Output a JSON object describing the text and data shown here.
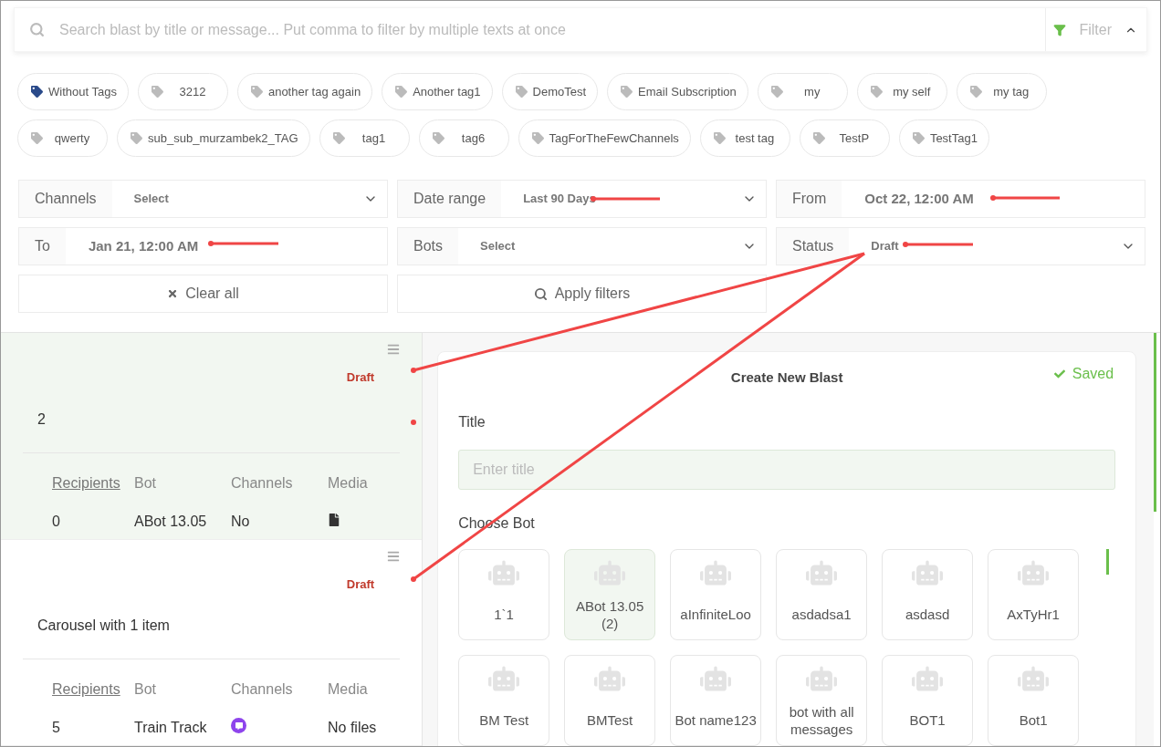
{
  "search": {
    "placeholder": "Search blast by title or message... Put comma to filter by multiple texts at once"
  },
  "filter_toggle": {
    "label": "Filter",
    "expanded": true
  },
  "tags": [
    {
      "label": "Without Tags",
      "kind": "none"
    },
    {
      "label": "3212",
      "kind": "tag"
    },
    {
      "label": "another tag again",
      "kind": "tag"
    },
    {
      "label": "Another tag1",
      "kind": "tag"
    },
    {
      "label": "DemoTest",
      "kind": "tag"
    },
    {
      "label": "Email Subscription",
      "kind": "tag"
    },
    {
      "label": "my",
      "kind": "tag"
    },
    {
      "label": "my self",
      "kind": "tag"
    },
    {
      "label": "my tag",
      "kind": "tag"
    },
    {
      "label": "qwerty",
      "kind": "tag"
    },
    {
      "label": "sub_sub_murzambek2_TAG",
      "kind": "tag"
    },
    {
      "label": "tag1",
      "kind": "tag"
    },
    {
      "label": "tag6",
      "kind": "tag"
    },
    {
      "label": "TagForTheFewChannels",
      "kind": "tag"
    },
    {
      "label": "test tag",
      "kind": "tag"
    },
    {
      "label": "TestP",
      "kind": "tag"
    },
    {
      "label": "TestTag1",
      "kind": "tag"
    }
  ],
  "filters": [
    {
      "label": "Channels",
      "value": "Select",
      "kind": "select"
    },
    {
      "label": "Date range",
      "value": "Last 90 Days",
      "kind": "select"
    },
    {
      "label": "From",
      "value": "Oct 22, 12:00 AM",
      "kind": "date"
    },
    {
      "label": "To",
      "value": "Jan 21, 12:00 AM",
      "kind": "date"
    },
    {
      "label": "Bots",
      "value": "Select",
      "kind": "select"
    },
    {
      "label": "Status",
      "value": "Draft",
      "kind": "select"
    }
  ],
  "filter_buttons": [
    {
      "label": "Clear all",
      "kind": "clear"
    },
    {
      "label": "Apply filters",
      "kind": "apply"
    }
  ],
  "blasts": [
    {
      "status": "Draft",
      "title": "2",
      "selected": true,
      "columns": [
        "Recipients",
        "Bot",
        "Channels",
        "Media"
      ],
      "recipients": "0",
      "bot": "ABot 13.05",
      "channels": {
        "kind": "text",
        "text": "No"
      },
      "media": {
        "kind": "file"
      }
    },
    {
      "status": "Draft",
      "title": "Carousel with 1 item",
      "selected": false,
      "columns": [
        "Recipients",
        "Bot",
        "Channels",
        "Media"
      ],
      "recipients": "5",
      "bot": "Train Track",
      "channels": {
        "kind": "chat"
      },
      "media": {
        "kind": "text",
        "text": "No files"
      }
    }
  ],
  "editor": {
    "heading": "Create New Blast",
    "saved": "Saved",
    "title_label": "Title",
    "title_placeholder": "Enter title",
    "bot_label": "Choose Bot",
    "bots": [
      {
        "name": "1`1",
        "selected": false
      },
      {
        "name": "ABot 13.05 (2)",
        "selected": true
      },
      {
        "name": "aInfiniteLoo",
        "selected": false
      },
      {
        "name": "asdadsa1",
        "selected": false
      },
      {
        "name": "asdasd",
        "selected": false
      },
      {
        "name": "AxTyHr1",
        "selected": false
      },
      {
        "name": "BM Test",
        "selected": false
      },
      {
        "name": "BMTest",
        "selected": false
      },
      {
        "name": "Bot name123",
        "selected": false
      },
      {
        "name": "bot with all messages",
        "selected": false
      },
      {
        "name": "BOT1",
        "selected": false
      },
      {
        "name": "Bot1",
        "selected": false
      }
    ]
  }
}
